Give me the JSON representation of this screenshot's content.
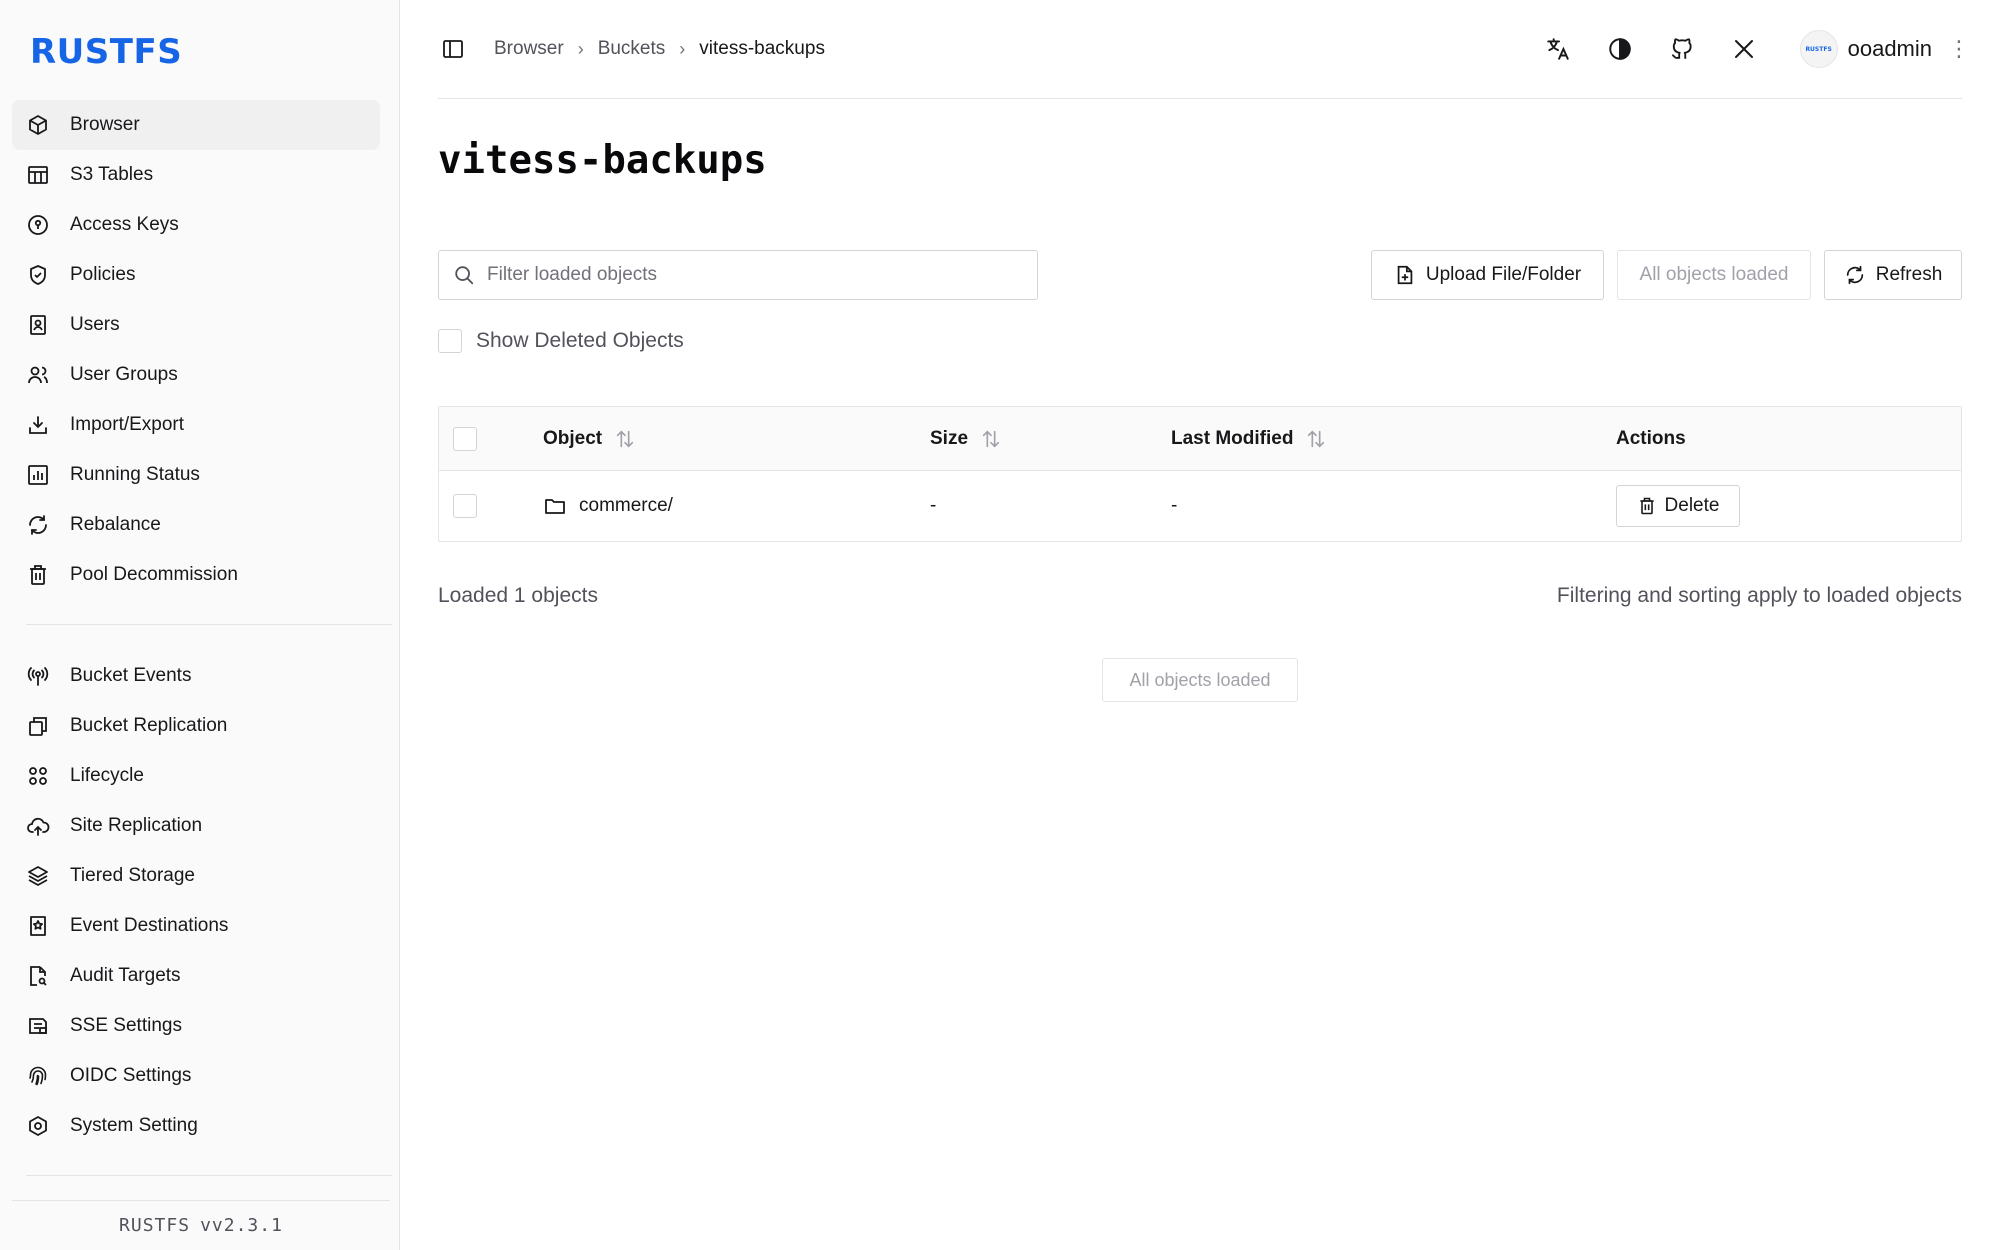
{
  "app": {
    "logo": "RUSTFS",
    "footer_name": "RUSTFS",
    "footer_version": "vv2.3.1"
  },
  "sidebar": {
    "group1": [
      {
        "label": "Browser",
        "icon": "cube-icon",
        "active": true
      },
      {
        "label": "S3 Tables",
        "icon": "table-icon"
      },
      {
        "label": "Access Keys",
        "icon": "key-circle-icon"
      },
      {
        "label": "Policies",
        "icon": "shield-check-icon"
      },
      {
        "label": "Users",
        "icon": "user-file-icon"
      },
      {
        "label": "User Groups",
        "icon": "users-icon"
      },
      {
        "label": "Import/Export",
        "icon": "download-tray-icon"
      },
      {
        "label": "Running Status",
        "icon": "bar-chart-icon"
      },
      {
        "label": "Rebalance",
        "icon": "refresh-icon"
      },
      {
        "label": "Pool Decommission",
        "icon": "trash-icon"
      }
    ],
    "group2": [
      {
        "label": "Bucket Events",
        "icon": "broadcast-icon"
      },
      {
        "label": "Bucket Replication",
        "icon": "copy-icon"
      },
      {
        "label": "Lifecycle",
        "icon": "lifecycle-icon"
      },
      {
        "label": "Site Replication",
        "icon": "cloud-upload-icon"
      },
      {
        "label": "Tiered Storage",
        "icon": "layers-icon"
      },
      {
        "label": "Event Destinations",
        "icon": "bookmark-star-icon"
      },
      {
        "label": "Audit Targets",
        "icon": "file-search-icon"
      },
      {
        "label": "SSE Settings",
        "icon": "lock-file-icon"
      },
      {
        "label": "OIDC Settings",
        "icon": "fingerprint-icon"
      },
      {
        "label": "System Setting",
        "icon": "hexagon-gear-icon"
      }
    ]
  },
  "header": {
    "breadcrumb": [
      "Browser",
      "Buckets",
      "vitess-backups"
    ],
    "avatar_text": "RUSTFS",
    "username": "ooadmin",
    "icons": [
      "translate-icon",
      "theme-icon",
      "github-icon",
      "x-icon"
    ]
  },
  "main": {
    "title": "vitess-backups",
    "search_placeholder": "Filter loaded objects",
    "upload_label": "Upload File/Folder",
    "all_loaded_label": "All objects loaded",
    "refresh_label": "Refresh",
    "show_deleted_label": "Show Deleted Objects",
    "table": {
      "columns": {
        "object": "Object",
        "size": "Size",
        "modified": "Last Modified",
        "actions": "Actions"
      },
      "rows": [
        {
          "name": "commerce/",
          "size": "-",
          "modified": "-",
          "action": "Delete"
        }
      ]
    },
    "loaded_count": "Loaded 1 objects",
    "loaded_note": "Filtering and sorting apply to loaded objects",
    "all_loaded_pill": "All objects loaded"
  },
  "colors": {
    "brand": "#1565e6",
    "border": "#e4e4e7",
    "muted": "#71717a"
  }
}
